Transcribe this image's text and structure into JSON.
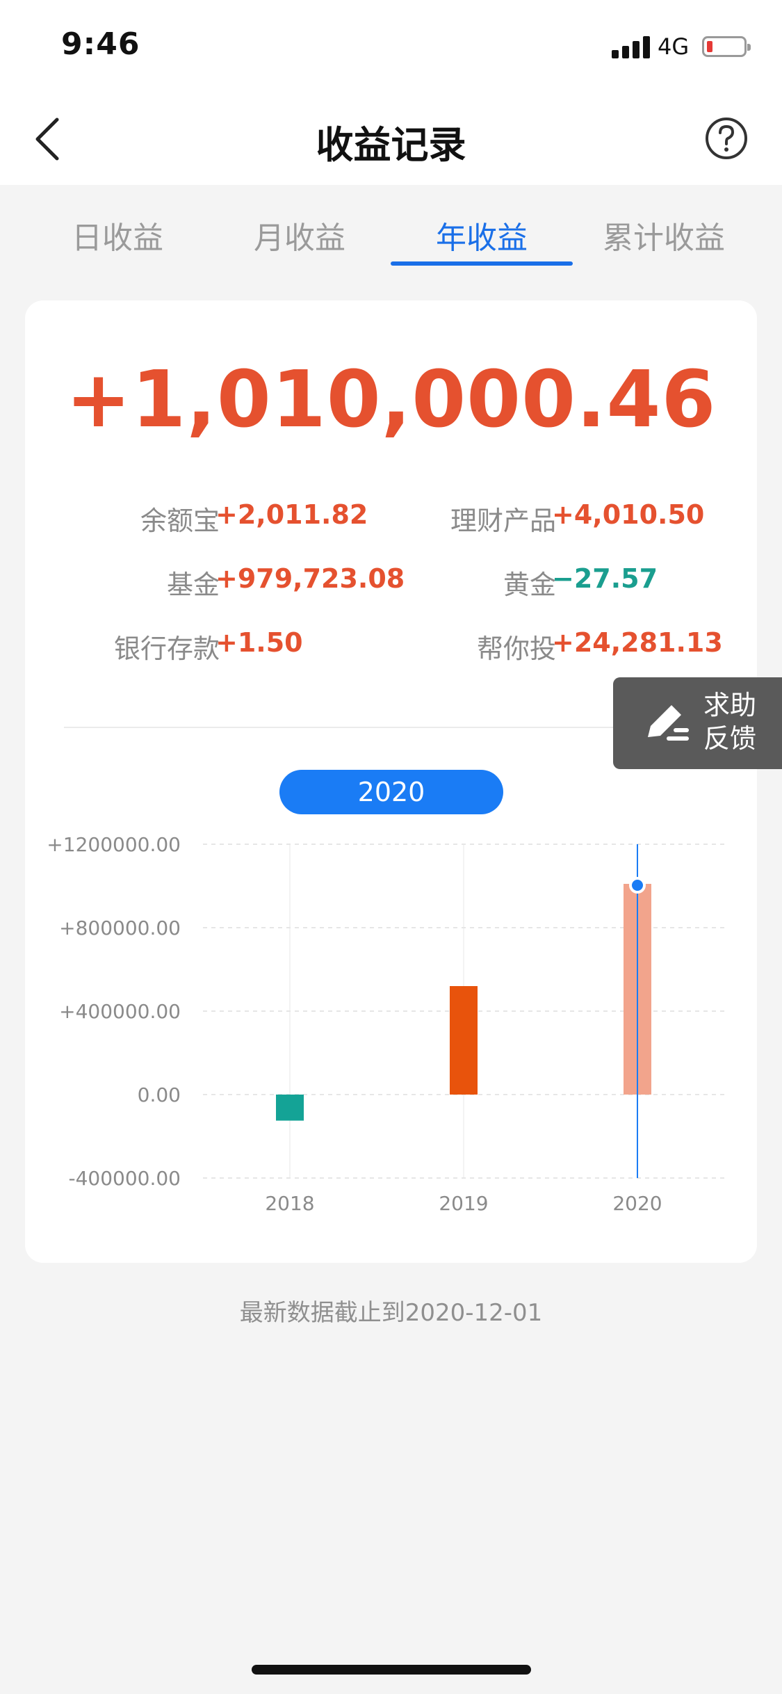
{
  "status_bar": {
    "time": "9:46",
    "network": "4G"
  },
  "nav": {
    "title": "收益记录",
    "back_icon": "chevron-left-icon",
    "help_icon": "question-circle-icon"
  },
  "tabs": [
    {
      "label": "日收益",
      "active": false
    },
    {
      "label": "月收益",
      "active": false
    },
    {
      "label": "年收益",
      "active": true
    },
    {
      "label": "累计收益",
      "active": false
    }
  ],
  "summary": {
    "total": "+1,010,000.46",
    "items": [
      {
        "label": "余额宝",
        "value": "+2,011.82"
      },
      {
        "label": "理财产品",
        "value": "+4,010.50"
      },
      {
        "label": "基金",
        "value": "+979,723.08"
      },
      {
        "label": "黄金",
        "value": "−27.57"
      },
      {
        "label": "银行存款",
        "value": "+1.50"
      },
      {
        "label": "帮你投",
        "value": "+24,281.13"
      }
    ]
  },
  "feedback": {
    "label_line1": "求助",
    "label_line2": "反馈",
    "icon": "pencil-icon"
  },
  "selected_year_label": "2020",
  "chart_data": {
    "type": "bar",
    "categories": [
      "2018",
      "2019",
      "2020"
    ],
    "values": [
      -125000,
      520000,
      1010000
    ],
    "ytick_labels": [
      "+1200000.00",
      "+800000.00",
      "+400000.00",
      "0.00",
      "-400000.00"
    ],
    "yticks": [
      1200000,
      800000,
      400000,
      0,
      -400000
    ],
    "ylim": [
      -400000,
      1200000
    ],
    "selected_index": 2,
    "grid": true,
    "colors": {
      "negative": "#14a396",
      "positive": "#e8530c",
      "selected": "#f2a48c",
      "cursor": "#1a7cf5"
    }
  },
  "footer_note": "最新数据截止到2020-12-01"
}
